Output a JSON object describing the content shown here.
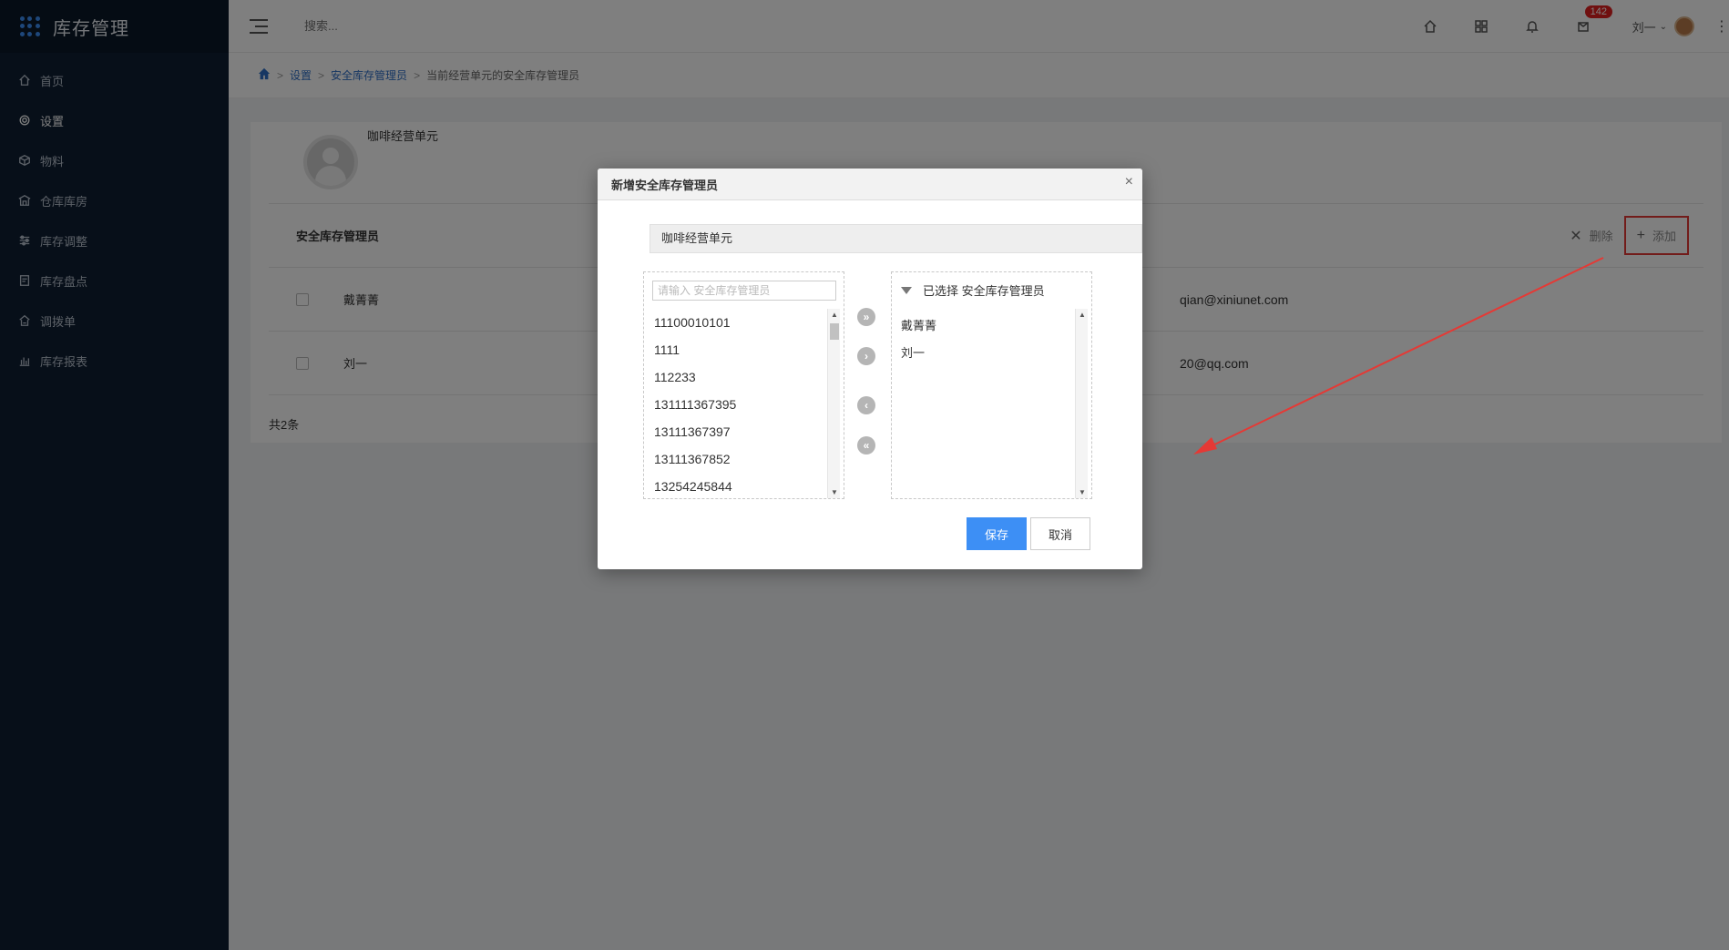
{
  "app": {
    "title": "库存管理"
  },
  "sidebar": {
    "items": [
      {
        "label": "首页",
        "icon": "home-icon"
      },
      {
        "label": "设置",
        "icon": "gear-icon"
      },
      {
        "label": "物料",
        "icon": "box-icon"
      },
      {
        "label": "仓库库房",
        "icon": "warehouse-icon"
      },
      {
        "label": "库存调整",
        "icon": "adjust-icon"
      },
      {
        "label": "库存盘点",
        "icon": "inventory-check-icon"
      },
      {
        "label": "调拨单",
        "icon": "transfer-icon"
      },
      {
        "label": "库存报表",
        "icon": "report-chart-icon"
      }
    ]
  },
  "header": {
    "search_placeholder": "搜索...",
    "notification_count": "142",
    "user_name": "刘一"
  },
  "breadcrumb": {
    "items": [
      "设置",
      "安全库存管理员",
      "当前经营单元的安全库存管理员"
    ]
  },
  "page": {
    "unit_name": "咖啡经营单元",
    "section_title": "安全库存管理员",
    "delete_label": "删除",
    "add_label": "添加",
    "rows": [
      {
        "name": "戴菁菁",
        "email": "qian@xiniunet.com"
      },
      {
        "name": "刘一",
        "email": "20@qq.com"
      }
    ],
    "total": "共2条"
  },
  "dialog": {
    "title": "新增安全库存管理员",
    "unit_value": "咖啡经营单元",
    "filter_placeholder": "请输入 安全库存管理员",
    "options": [
      "11100010101",
      "1111",
      "112233",
      "131111367395",
      "13111367397",
      "13111367852",
      "13254245844"
    ],
    "selected_header": "已选择 安全库存管理员",
    "selected": [
      "戴菁菁",
      "刘一"
    ],
    "save_label": "保存",
    "cancel_label": "取消"
  },
  "colors": {
    "sidebar_bg": "#0f1f33",
    "primary": "#3d8ff5",
    "annotation": "#e53935"
  }
}
